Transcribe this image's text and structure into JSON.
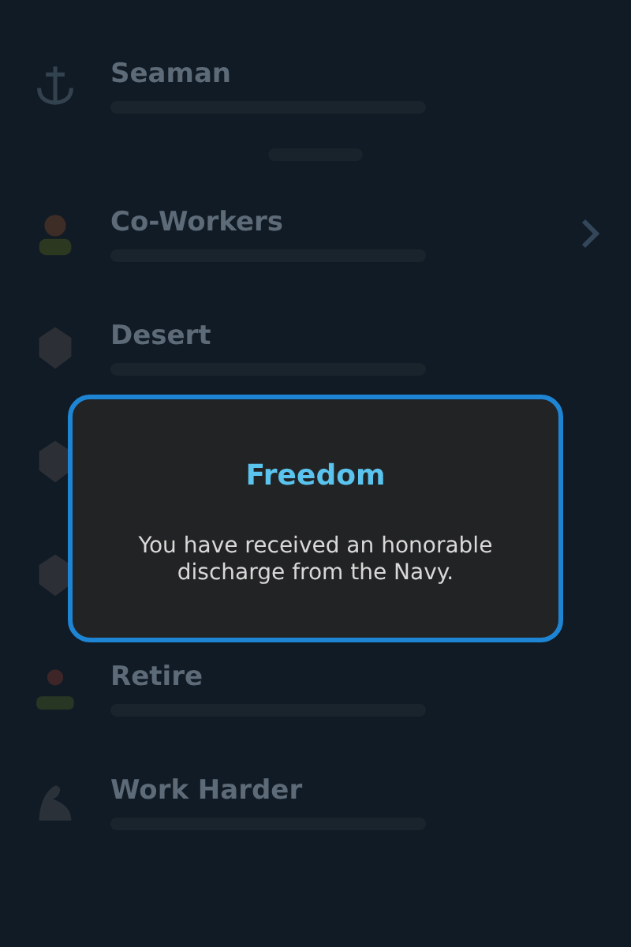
{
  "rows": [
    {
      "kind": "anchor",
      "title": "Seaman",
      "chevron": false
    },
    {
      "kind": "people",
      "title": "Co-Workers",
      "chevron": true
    },
    {
      "kind": "shape",
      "title": "Desert",
      "chevron": false
    },
    {
      "kind": "shape",
      "chevron": false
    },
    {
      "kind": "shape",
      "chevron": false
    },
    {
      "kind": "person",
      "title": "Retire",
      "chevron": false
    },
    {
      "kind": "arm",
      "title": "Work Harder",
      "chevron": false
    }
  ],
  "dialog": {
    "title": "Freedom",
    "message": "You have received an honorable discharge from the Navy."
  }
}
